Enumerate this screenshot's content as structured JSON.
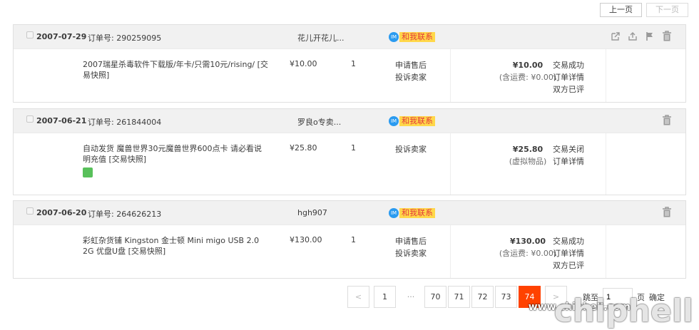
{
  "top_pager": {
    "prev": "上一页",
    "next": "下一页"
  },
  "orders": [
    {
      "date": "2007-07-29",
      "order_no": "订单号: 290259095",
      "seller": "花儿开花儿...",
      "contact": "和我联系",
      "title": "2007瑞星杀毒软件下载版/年卡/只需10元/rising/ [交易快照]",
      "price": "¥10.00",
      "qty": "1",
      "services": [
        "申请售后",
        "投诉卖家"
      ],
      "total": "¥10.00",
      "total_sub": "(含运费: ¥0.00)",
      "status": [
        "交易成功",
        "订单详情",
        "双方已评"
      ]
    },
    {
      "date": "2007-06-21",
      "order_no": "订单号: 261844004",
      "seller": "罗良o专卖...",
      "contact": "和我联系",
      "title": "自动发货 魔兽世界30元魔兽世界600点卡 请必看说明充值 [交易快照]",
      "price": "¥25.80",
      "qty": "1",
      "services": [
        "投诉卖家"
      ],
      "total": "¥25.80",
      "total_sub": "(虚拟物品)",
      "status": [
        "交易关闭",
        "订单详情"
      ]
    },
    {
      "date": "2007-06-20",
      "order_no": "订单号: 264626213",
      "seller": "hgh907",
      "contact": "和我联系",
      "title": "彩虹杂货铺 Kingston 金士顿 Mini migo USB 2.0 2G 优盘U盘 [交易快照]",
      "price": "¥130.00",
      "qty": "1",
      "services": [
        "申请售后",
        "投诉卖家"
      ],
      "total": "¥130.00",
      "total_sub": "(含运费: ¥0.00)",
      "status": [
        "交易成功",
        "订单详情",
        "双方已评"
      ]
    }
  ],
  "pager": {
    "prev": "<",
    "first": "1",
    "ellipsis": "···",
    "pages": [
      "70",
      "71",
      "72",
      "73",
      "74"
    ],
    "active": "74",
    "next": ">",
    "jump_label": "跳至",
    "jump_value": "1",
    "jump_suffix": "页",
    "confirm": "确定"
  },
  "watermark": {
    "logo": "chiphell",
    "url": "www.chiphell.com"
  },
  "colors": {
    "active_page": "#ff4200",
    "contact_bg": "#ffd84a",
    "contact_text": "#e4393c",
    "im_icon": "#2b9bf0"
  }
}
